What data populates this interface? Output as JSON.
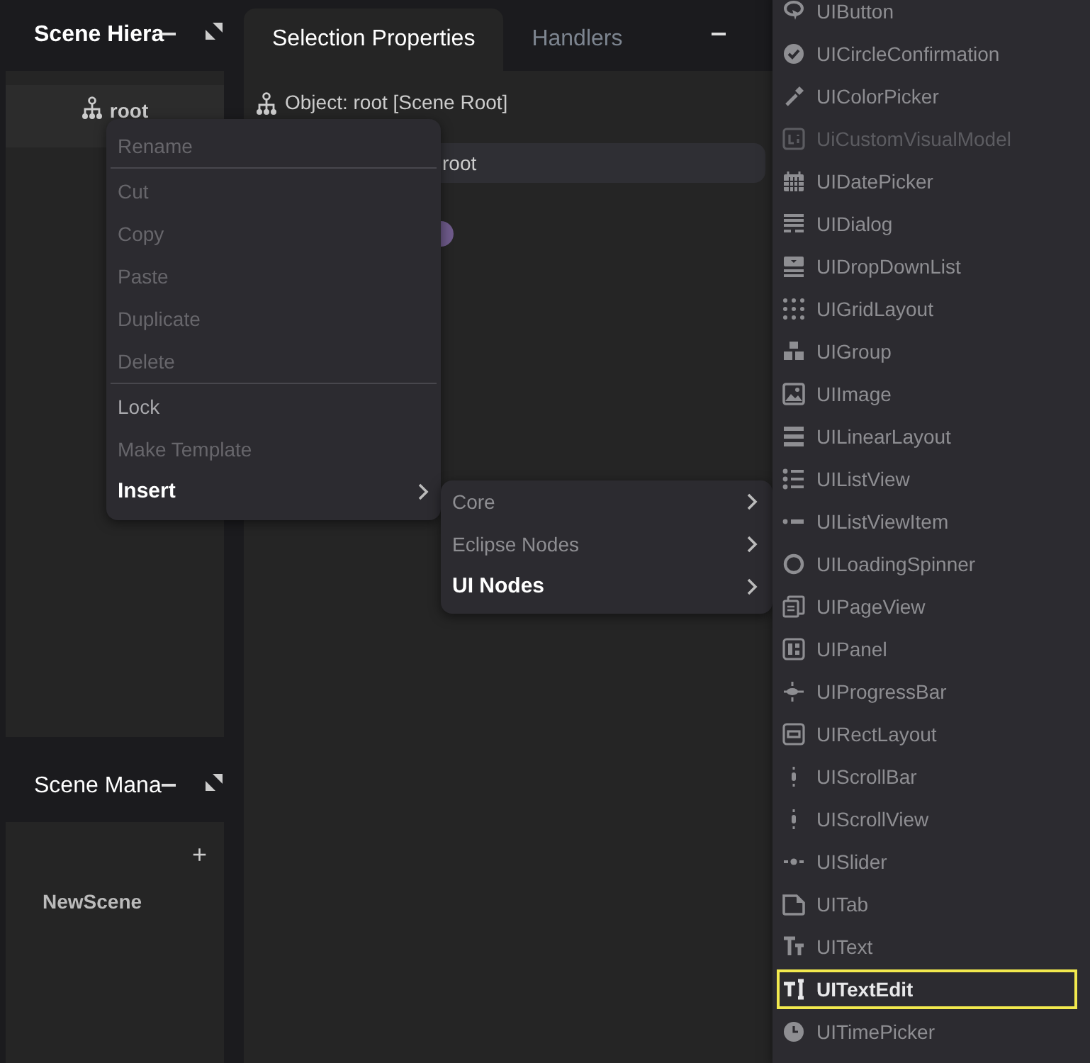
{
  "hierarchy_panel": {
    "title": "Scene Hiera",
    "tree": [
      {
        "label": "root",
        "selected": true
      }
    ]
  },
  "properties_panel": {
    "tabs": [
      {
        "label": "Selection Properties",
        "selected": true
      },
      {
        "label": "Handlers",
        "selected": false
      }
    ],
    "object_label": "Object: root [Scene Root]",
    "name_field": {
      "value": "root"
    }
  },
  "scene_manager_panel": {
    "title": "Scene Mana",
    "add_button": "+",
    "scenes": [
      "NewScene"
    ]
  },
  "context_menu": {
    "items": [
      {
        "kind": "item",
        "label": "Rename",
        "disabled": true,
        "expanded": false
      },
      {
        "kind": "separator"
      },
      {
        "kind": "item",
        "label": "Cut",
        "disabled": true,
        "expanded": false
      },
      {
        "kind": "item",
        "label": "Copy",
        "disabled": true,
        "expanded": false
      },
      {
        "kind": "item",
        "label": "Paste",
        "disabled": true,
        "expanded": false
      },
      {
        "kind": "item",
        "label": "Duplicate",
        "disabled": true,
        "expanded": false
      },
      {
        "kind": "item",
        "label": "Delete",
        "disabled": true,
        "expanded": false
      },
      {
        "kind": "separator"
      },
      {
        "kind": "item",
        "label": "Lock",
        "disabled": false,
        "expanded": false
      },
      {
        "kind": "item",
        "label": "Make Template",
        "disabled": true,
        "expanded": false
      },
      {
        "kind": "submenu",
        "label": "Insert",
        "disabled": false,
        "expanded": true
      }
    ]
  },
  "insert_submenu": {
    "items": [
      {
        "kind": "submenu",
        "label": "Core",
        "expanded": false
      },
      {
        "kind": "submenu",
        "label": "Eclipse Nodes",
        "expanded": false
      },
      {
        "kind": "submenu",
        "label": "UI Nodes",
        "expanded": true
      }
    ]
  },
  "ui_nodes_submenu": {
    "items": [
      {
        "label": "UIButton",
        "disabled": false,
        "selected": false
      },
      {
        "label": "UICircleConfirmation",
        "disabled": false,
        "selected": false
      },
      {
        "label": "UIColorPicker",
        "disabled": false,
        "selected": false
      },
      {
        "label": "UiCustomVisualModel",
        "disabled": true,
        "selected": false
      },
      {
        "label": "UIDatePicker",
        "disabled": false,
        "selected": false
      },
      {
        "label": "UIDialog",
        "disabled": false,
        "selected": false
      },
      {
        "label": "UIDropDownList",
        "disabled": false,
        "selected": false
      },
      {
        "label": "UIGridLayout",
        "disabled": false,
        "selected": false
      },
      {
        "label": "UIGroup",
        "disabled": false,
        "selected": false
      },
      {
        "label": "UIImage",
        "disabled": false,
        "selected": false
      },
      {
        "label": "UILinearLayout",
        "disabled": false,
        "selected": false
      },
      {
        "label": "UIListView",
        "disabled": false,
        "selected": false
      },
      {
        "label": "UIListViewItem",
        "disabled": false,
        "selected": false
      },
      {
        "label": "UILoadingSpinner",
        "disabled": false,
        "selected": false
      },
      {
        "label": "UIPageView",
        "disabled": false,
        "selected": false
      },
      {
        "label": "UIPanel",
        "disabled": false,
        "selected": false
      },
      {
        "label": "UIProgressBar",
        "disabled": false,
        "selected": false
      },
      {
        "label": "UIRectLayout",
        "disabled": false,
        "selected": false
      },
      {
        "label": "UIScrollBar",
        "disabled": false,
        "selected": false
      },
      {
        "label": "UIScrollView",
        "disabled": false,
        "selected": false
      },
      {
        "label": "UISlider",
        "disabled": false,
        "selected": false
      },
      {
        "label": "UITab",
        "disabled": false,
        "selected": false
      },
      {
        "label": "UIText",
        "disabled": false,
        "selected": false
      },
      {
        "label": "UITextEdit",
        "disabled": false,
        "selected": true
      },
      {
        "label": "UITimePicker",
        "disabled": false,
        "selected": false
      }
    ]
  }
}
